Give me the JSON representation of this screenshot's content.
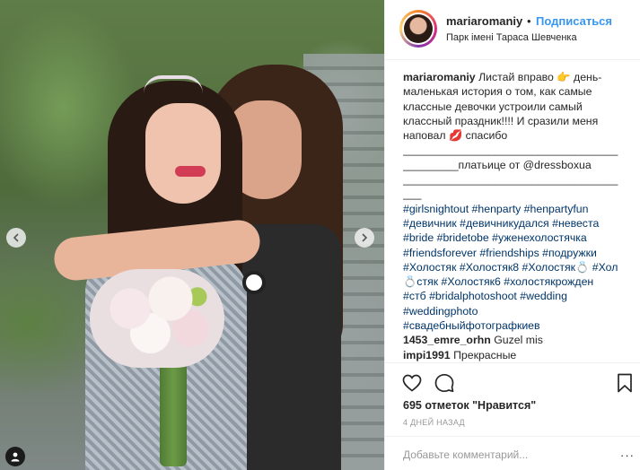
{
  "post": {
    "username": "mariaromaniy",
    "separator": "•",
    "follow_label": "Подписаться",
    "location": "Парк імені Тараса Шевченка"
  },
  "caption": {
    "username": "mariaromaniy",
    "text_lines": [
      "Листай вправо 👉 день-",
      "маленькая история о том, как самые",
      "классные девочки устроили самый",
      "классный праздник!!!! И сразили меня",
      "наповал 💋 спасибо",
      "___________________________________",
      "_________платьице от @dressboxua",
      "___________________________________",
      "___",
      "#girlsnightout #henparty #henpartyfun",
      "#девичник #девичникудался #невеста",
      "#bride #bridetobe #уженехолостячка",
      "#friendsforever #friendships #подружки",
      "#Холостяк #Холостяк8 #Холостяк💍 #Хол",
      "💍стяк #Холостяк6 #холостякрожден",
      "#стб #bridalphotoshoot #wedding",
      "#weddingphoto",
      "#свадебныйфотографкиев"
    ]
  },
  "replies": [
    {
      "username": "1453_emre_orhn",
      "text": "Guzel mis"
    },
    {
      "username": "impi1991",
      "text": "Прекрасные"
    }
  ],
  "likes_text": "695 отметок \"Нравится\"",
  "date_text": "4 ДНЕЙ НАЗАД",
  "comment_box": {
    "placeholder": "Добавьте комментарий...",
    "more_label": "···"
  },
  "colors": {
    "link_blue": "#3897f0",
    "hashtag": "#003569",
    "muted": "#999999"
  }
}
